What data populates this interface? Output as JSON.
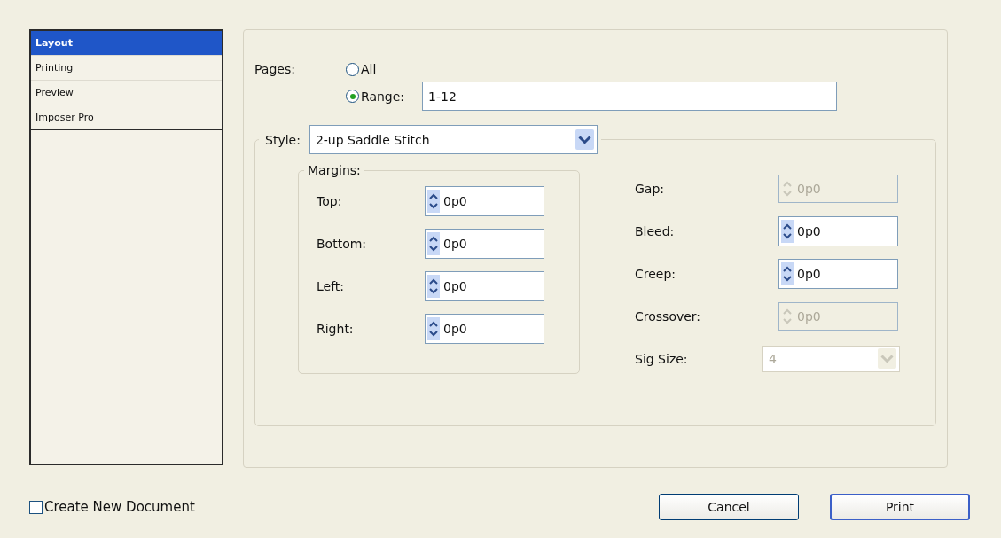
{
  "sidebar": {
    "items": [
      {
        "label": "Layout",
        "selected": true
      },
      {
        "label": "Printing",
        "selected": false
      },
      {
        "label": "Preview",
        "selected": false
      },
      {
        "label": "Imposer Pro",
        "selected": false
      }
    ]
  },
  "pages": {
    "label": "Pages:",
    "options": [
      {
        "label": "All",
        "selected": false
      },
      {
        "label": "Range:",
        "selected": true
      }
    ],
    "range_value": "1-12"
  },
  "style": {
    "label": "Style:",
    "value": "2-up Saddle Stitch"
  },
  "margins": {
    "title": "Margins:",
    "fields": [
      {
        "label": "Top:",
        "value": "0p0"
      },
      {
        "label": "Bottom:",
        "value": "0p0"
      },
      {
        "label": "Left:",
        "value": "0p0"
      },
      {
        "label": "Right:",
        "value": "0p0"
      }
    ]
  },
  "options": [
    {
      "label": "Gap:",
      "value": "0p0",
      "kind": "spinner",
      "disabled": true
    },
    {
      "label": "Bleed:",
      "value": "0p0",
      "kind": "spinner",
      "disabled": false
    },
    {
      "label": "Creep:",
      "value": "0p0",
      "kind": "spinner",
      "disabled": false
    },
    {
      "label": "Crossover:",
      "value": "0p0",
      "kind": "spinner",
      "disabled": true
    },
    {
      "label": "Sig Size:",
      "value": "4",
      "kind": "dropdown",
      "disabled": true
    }
  ],
  "create_new_document": {
    "label": "Create New Document",
    "checked": false
  },
  "buttons": [
    {
      "label": "Cancel",
      "default": false
    },
    {
      "label": "Print",
      "default": true
    }
  ]
}
